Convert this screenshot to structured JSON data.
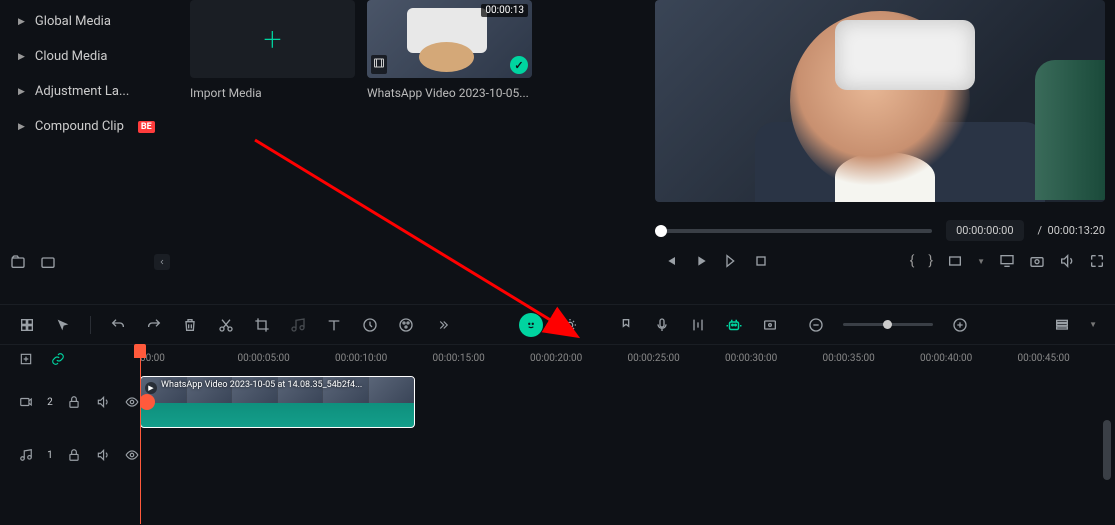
{
  "sidebar": {
    "items": [
      {
        "label": "Global Media"
      },
      {
        "label": "Cloud Media"
      },
      {
        "label": "Adjustment La..."
      },
      {
        "label": "Compound Clip"
      }
    ]
  },
  "media": {
    "import_label": "Import Media",
    "clip_name": "WhatsApp Video 2023-10-05...",
    "clip_duration": "00:00:13"
  },
  "preview": {
    "current_time": "00:00:00:00",
    "sep": "/",
    "total_time": "00:00:13:20"
  },
  "ruler": {
    "marks": [
      "00:00",
      "00:00:05:00",
      "00:00:10:00",
      "00:00:15:00",
      "00:00:20:00",
      "00:00:25:00",
      "00:00:30:00",
      "00:00:35:00",
      "00:00:40:00",
      "00:00:45:00"
    ]
  },
  "tracks": {
    "video_clip_label": "WhatsApp Video 2023-10-05 at 14.08.35_54b2f4...",
    "track_video_num": "2",
    "track_audio_num": "1"
  }
}
